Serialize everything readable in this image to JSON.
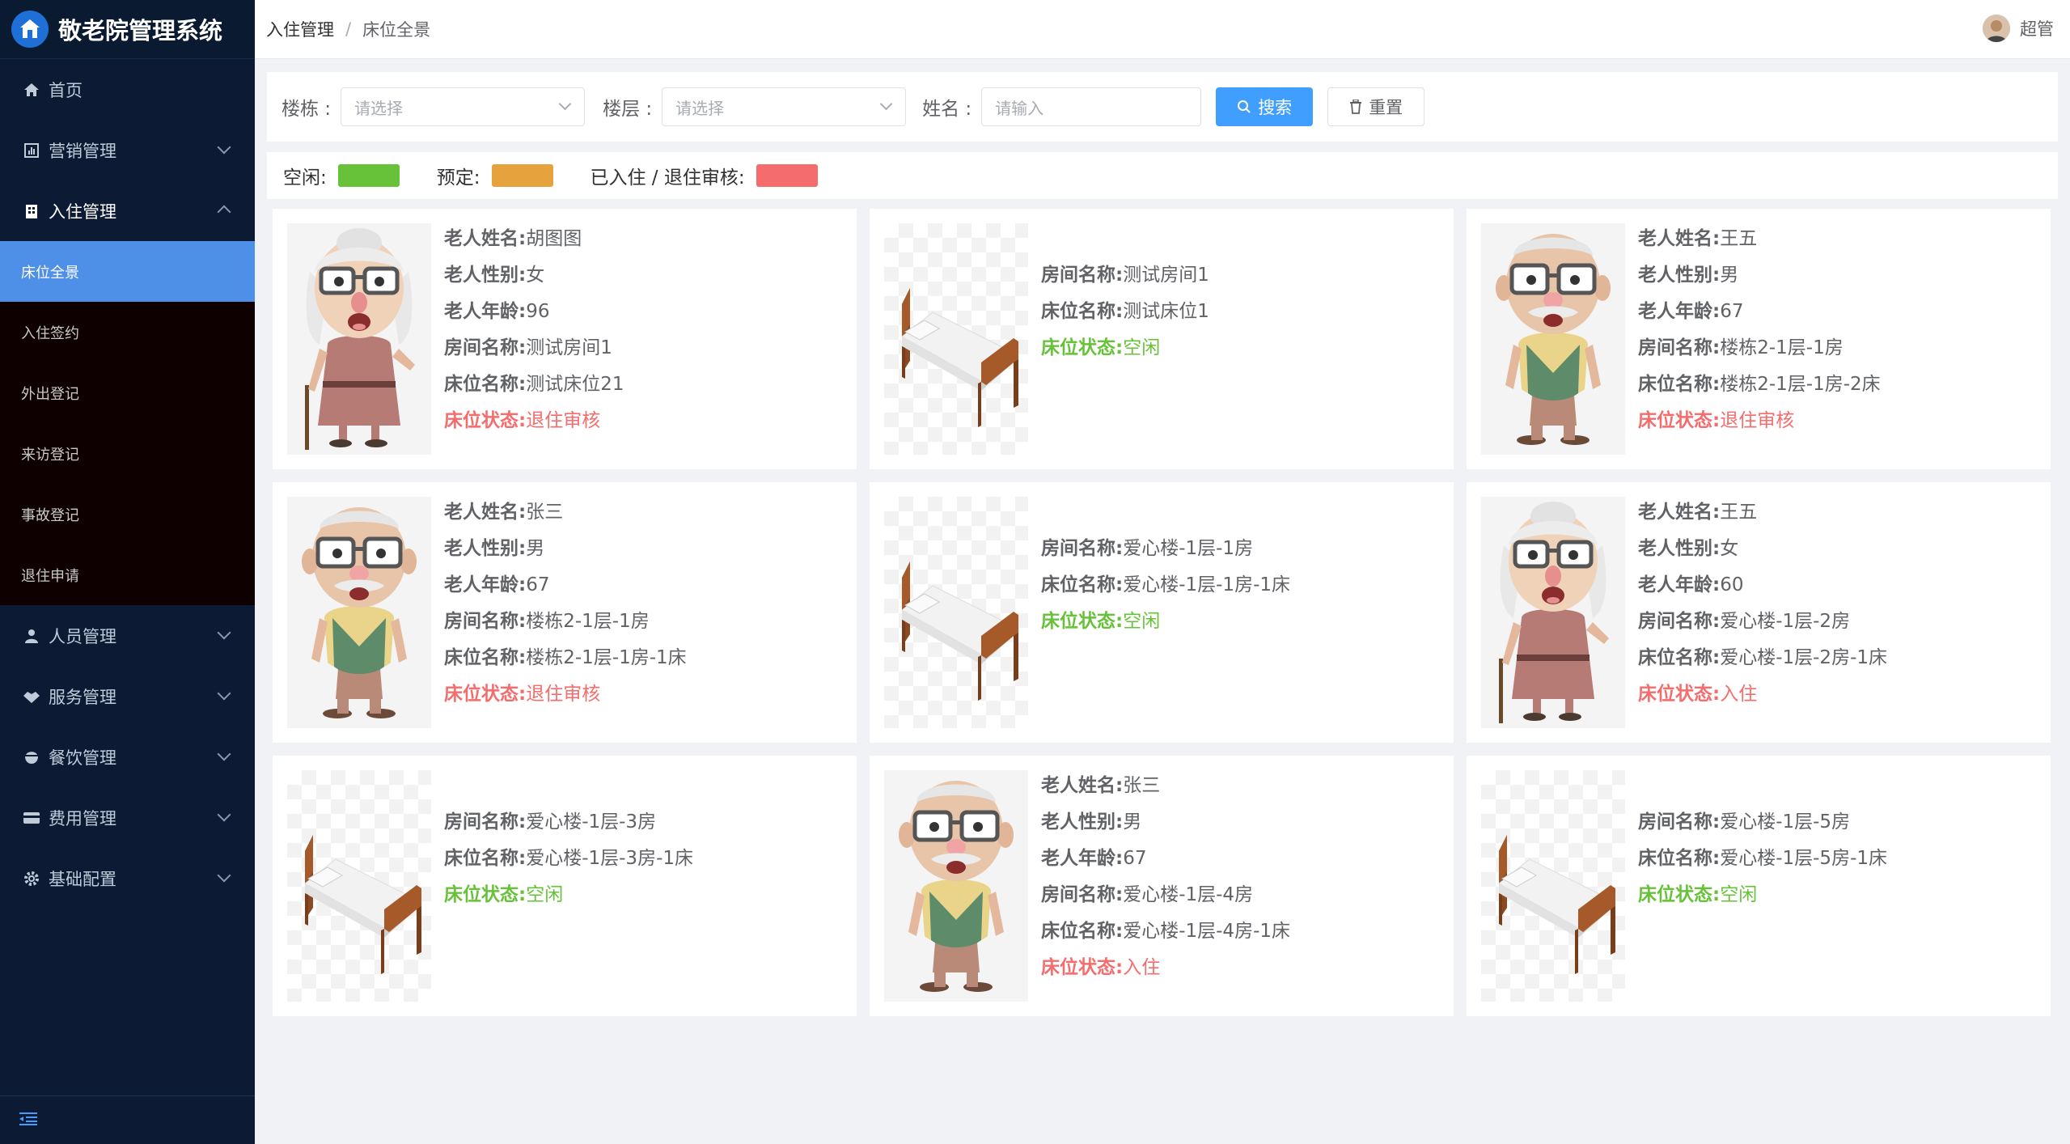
{
  "app": {
    "title": "敬老院管理系统"
  },
  "colors": {
    "accent": "#409eff",
    "idle": "#67c23a",
    "reserved": "#e6a23c",
    "occupied": "#f56c6c",
    "sidebar_bg": "#0c1b33"
  },
  "sidebar": {
    "items": [
      {
        "label": "首页",
        "icon": "home-icon"
      },
      {
        "label": "营销管理",
        "icon": "chart-icon"
      },
      {
        "label": "入住管理",
        "icon": "building-icon"
      },
      {
        "label": "人员管理",
        "icon": "user-icon"
      },
      {
        "label": "服务管理",
        "icon": "handshake-icon"
      },
      {
        "label": "餐饮管理",
        "icon": "bowl-icon"
      },
      {
        "label": "费用管理",
        "icon": "card-icon"
      },
      {
        "label": "基础配置",
        "icon": "gear-icon"
      }
    ],
    "submenu": [
      "床位全景",
      "入住签约",
      "外出登记",
      "来访登记",
      "事故登记",
      "退住申请"
    ],
    "collapse_icon": "menu-fold-icon"
  },
  "header": {
    "breadcrumb": [
      "入住管理",
      "床位全景"
    ],
    "separator": "/",
    "user": "超管"
  },
  "search": {
    "building_label": "楼栋 :",
    "building_placeholder": "请选择",
    "floor_label": "楼层 :",
    "floor_placeholder": "请选择",
    "name_label": "姓名 :",
    "name_placeholder": "请输入",
    "search_button": "搜索",
    "reset_button": "重置"
  },
  "legend": {
    "idle": "空闲:",
    "reserved": "预定:",
    "occupied": "已入住 / 退住审核:"
  },
  "field_labels": {
    "name": "老人姓名:",
    "gender": "老人性别:",
    "age": "老人年龄:",
    "room": "房间名称:",
    "bed": "床位名称:",
    "status": "床位状态:"
  },
  "cards": [
    {
      "type": "grandma",
      "name": "胡图图",
      "gender": "女",
      "age": "96",
      "room": "测试房间1",
      "bed": "测试床位21",
      "status": "退住审核",
      "status_color": "red"
    },
    {
      "type": "bed",
      "room": "测试房间1",
      "bed": "测试床位1",
      "status": "空闲",
      "status_color": "green"
    },
    {
      "type": "grandpa",
      "name": "王五",
      "gender": "男",
      "age": "67",
      "room": "楼栋2-1层-1房",
      "bed": "楼栋2-1层-1房-2床",
      "status": "退住审核",
      "status_color": "red"
    },
    {
      "type": "grandpa",
      "name": "张三",
      "gender": "男",
      "age": "67",
      "room": "楼栋2-1层-1房",
      "bed": "楼栋2-1层-1房-1床",
      "status": "退住审核",
      "status_color": "red"
    },
    {
      "type": "bed",
      "room": "爱心楼-1层-1房",
      "bed": "爱心楼-1层-1房-1床",
      "status": "空闲",
      "status_color": "green"
    },
    {
      "type": "grandma",
      "name": "王五",
      "gender": "女",
      "age": "60",
      "room": "爱心楼-1层-2房",
      "bed": "爱心楼-1层-2房-1床",
      "status": "入住",
      "status_color": "red"
    },
    {
      "type": "bed",
      "room": "爱心楼-1层-3房",
      "bed": "爱心楼-1层-3房-1床",
      "status": "空闲",
      "status_color": "green"
    },
    {
      "type": "grandpa",
      "name": "张三",
      "gender": "男",
      "age": "67",
      "room": "爱心楼-1层-4房",
      "bed": "爱心楼-1层-4房-1床",
      "status": "入住",
      "status_color": "red"
    },
    {
      "type": "bed",
      "room": "爱心楼-1层-5房",
      "bed": "爱心楼-1层-5房-1床",
      "status": "空闲",
      "status_color": "green"
    }
  ]
}
